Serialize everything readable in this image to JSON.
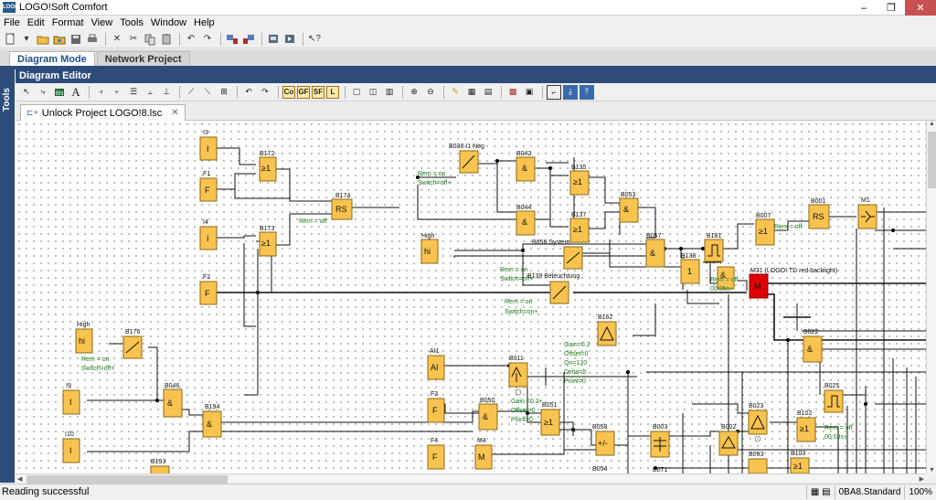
{
  "window": {
    "title": "LOGO!Soft Comfort",
    "icon": "logo-app-icon",
    "minimize": "–",
    "restore": "❐",
    "close": "✕"
  },
  "menu": [
    "File",
    "Edit",
    "Format",
    "View",
    "Tools",
    "Window",
    "Help"
  ],
  "mode_tabs": [
    {
      "label": "Diagram Mode",
      "active": true
    },
    {
      "label": "Network Project",
      "active": false
    }
  ],
  "sidebar": {
    "label": "Tools"
  },
  "editor": {
    "title": "Diagram Editor"
  },
  "editor_toolbar": {
    "co": "Co",
    "gf": "GF",
    "sf": "SF",
    "l": "L"
  },
  "document_tab": {
    "label": "Unlock Project LOGO!8.lsc",
    "close": "✕"
  },
  "status": {
    "left": "Reading successful",
    "device": "0BA8.Standard",
    "zoom": "100%"
  },
  "diagram": {
    "inputs": {
      "i3": "I3",
      "f1": "F1",
      "i4": "I4",
      "f2": "F2",
      "high_top": "High",
      "high_left": "High",
      "i9": "I9",
      "i10": "I10",
      "ai1": "AI1",
      "f3": "F3",
      "f4": "F4"
    },
    "blocks": {
      "i": "I",
      "f": "F",
      "hi": "hi",
      "ai": "AI",
      "or": "≥1",
      "and": "&",
      "rs": "RS",
      "m": "M",
      "one": "1",
      "b172": "B172",
      "b173": "B173",
      "b174": "B174",
      "b038": "B038 I1 Neg",
      "b042": "B042",
      "b044": "B044",
      "b135": "B135",
      "b137": "B137",
      "b053": "B053",
      "b056": "B056 System",
      "b057": "B057",
      "b138": "B138",
      "b181": "B181",
      "b007": "B007",
      "b001": "B001",
      "m1": "M1",
      "b139": "B139 Beleuchtung",
      "m31": "M31 (LOGO! TD red backlight)",
      "b176": "B176",
      "b162": "B162",
      "b011": "B011",
      "b046": "B046",
      "b194": "B194",
      "b050": "B050",
      "b051": "B051",
      "m4": "M4",
      "b058": "B058",
      "b003": "B003",
      "b002": "B002",
      "b023": "B023",
      "b022": "B022",
      "b025": "B025",
      "b102": "B102",
      "b193": "B193",
      "b103": "B103",
      "b054": "B054",
      "b093": "B093",
      "b071": "B071"
    },
    "params": {
      "rem_off": "Rem = off",
      "rem_on": "Rem = on",
      "switch_off": "Switch=off+",
      "switch_on": "Switch=on+",
      "rem_on_sw": "Rem = on",
      "switch_off_sw": "Switch=off+",
      "rem_off_b": "Rem = off",
      "time_05": "00:05s+",
      "time_03": "00:03s+",
      "gain": "Gain=0.2",
      "offset": "Offset=0",
      "on120": "On=120",
      "delta": "Delta=5",
      "point": "Point=0",
      "gain2": "Gain =0.2+",
      "offset2": "Offset=0",
      "point2": "Point=0"
    }
  }
}
